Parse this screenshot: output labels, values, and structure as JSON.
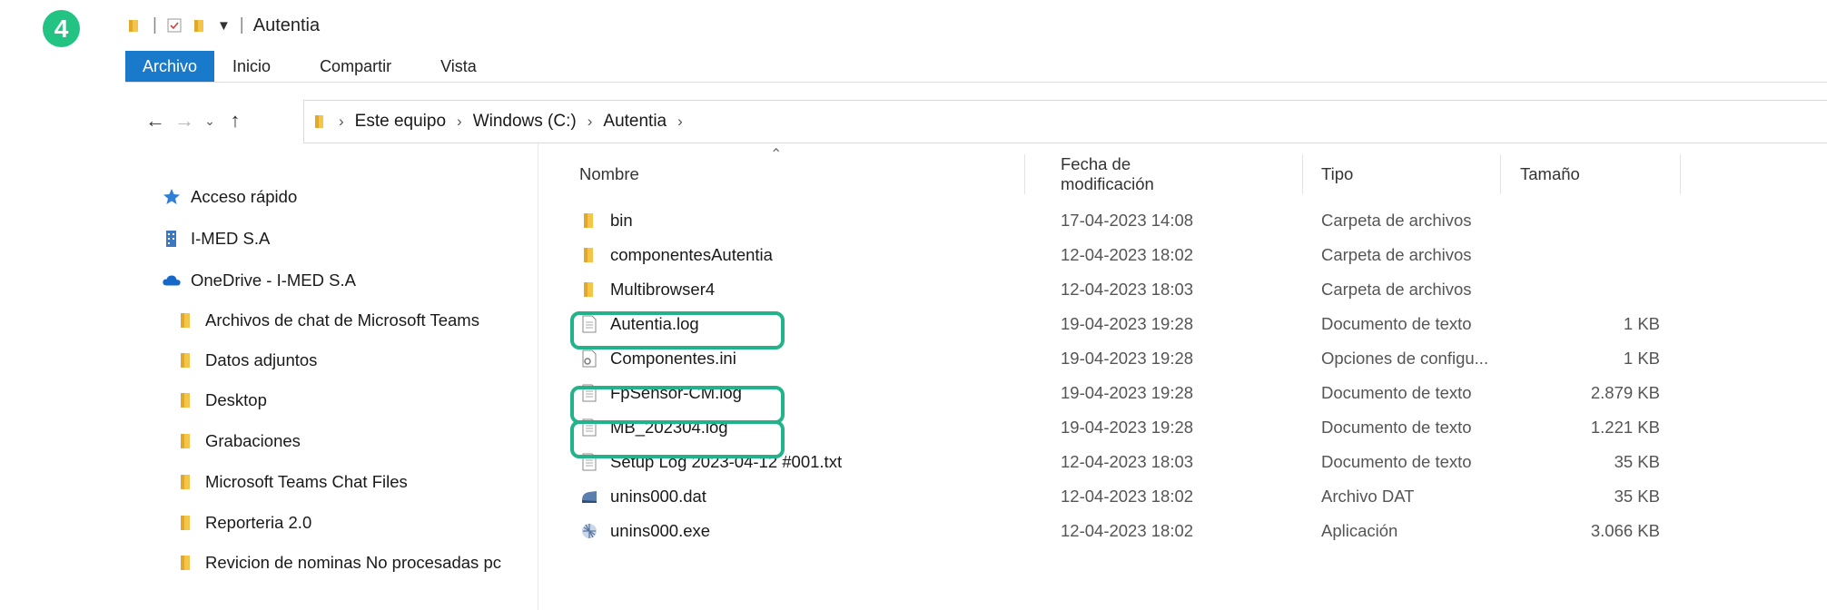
{
  "step_badge": "4",
  "window": {
    "title": "Autentia",
    "quick_access": [
      "folder-icon",
      "properties-icon",
      "new-folder-icon"
    ]
  },
  "ribbon": {
    "tabs": [
      "Archivo",
      "Inicio",
      "Compartir",
      "Vista"
    ]
  },
  "address_bar": {
    "crumbs": [
      "Este equipo",
      "Windows (C:)",
      "Autentia"
    ]
  },
  "sidebar": {
    "quick_access": "Acceso rápido",
    "org": "I-MED S.A",
    "onedrive": "OneDrive - I-MED S.A",
    "folders": [
      "Archivos de chat de Microsoft Teams",
      "Datos adjuntos",
      "Desktop",
      "Grabaciones",
      "Microsoft Teams Chat Files",
      "Reporteria 2.0",
      "Revicion de nominas No procesadas pc"
    ]
  },
  "columns": {
    "name": "Nombre",
    "date": "Fecha de modificación",
    "type": "Tipo",
    "size": "Tamaño"
  },
  "files": [
    {
      "name": "bin",
      "date": "17-04-2023 14:08",
      "type": "Carpeta de archivos",
      "size": "",
      "icon": "folder-icon"
    },
    {
      "name": "componentesAutentia",
      "date": "12-04-2023 18:02",
      "type": "Carpeta de archivos",
      "size": "",
      "icon": "folder-icon"
    },
    {
      "name": "Multibrowser4",
      "date": "12-04-2023 18:03",
      "type": "Carpeta de archivos",
      "size": "",
      "icon": "folder-icon"
    },
    {
      "name": "Autentia.log",
      "date": "19-04-2023 19:28",
      "type": "Documento de texto",
      "size": "1 KB",
      "icon": "text-file-icon"
    },
    {
      "name": "Componentes.ini",
      "date": "19-04-2023 19:28",
      "type": "Opciones de configu...",
      "size": "1 KB",
      "icon": "ini-file-icon"
    },
    {
      "name": "FpSensor-CM.log",
      "date": "19-04-2023 19:28",
      "type": "Documento de texto",
      "size": "2.879 KB",
      "icon": "text-file-icon"
    },
    {
      "name": "MB_202304.log",
      "date": "19-04-2023 19:28",
      "type": "Documento de texto",
      "size": "1.221 KB",
      "icon": "text-file-icon"
    },
    {
      "name": "Setup Log 2023-04-12 #001.txt",
      "date": "12-04-2023 18:03",
      "type": "Documento de texto",
      "size": "35 KB",
      "icon": "text-file-icon"
    },
    {
      "name": "unins000.dat",
      "date": "12-04-2023 18:02",
      "type": "Archivo DAT",
      "size": "35 KB",
      "icon": "dat-file-icon"
    },
    {
      "name": "unins000.exe",
      "date": "12-04-2023 18:02",
      "type": "Aplicación",
      "size": "3.066 KB",
      "icon": "exe-file-icon"
    }
  ],
  "highlight_color": "#22b38a",
  "accent_color": "#1979ca"
}
